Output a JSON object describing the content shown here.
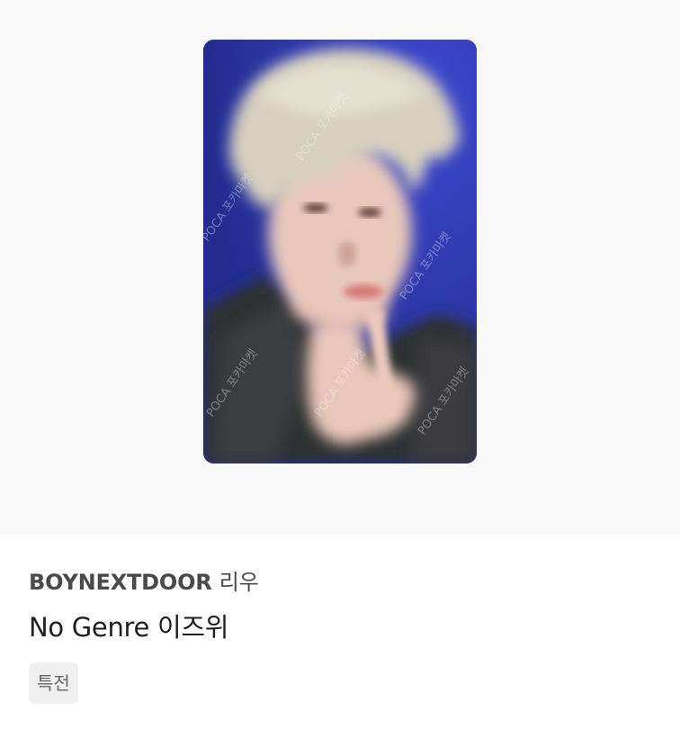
{
  "product": {
    "image_alt": "BOYNEXTDOOR 리우 photocard",
    "watermark": "POCA 포카마켓",
    "artist": "BOYNEXTDOOR",
    "member": "리우",
    "album": "No Genre 이즈위",
    "tag": "특전"
  },
  "colors": {
    "hero_background": "#f8f8f9",
    "photo_background": "#2b37a8",
    "tag_background": "#f0f0f0"
  }
}
